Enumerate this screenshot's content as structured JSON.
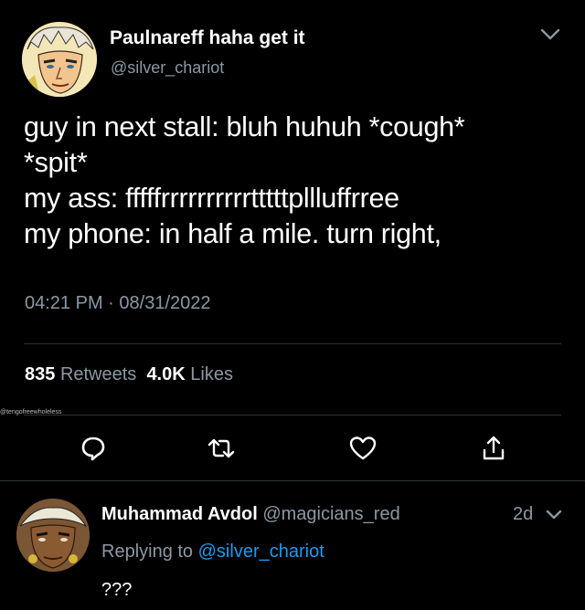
{
  "tweet": {
    "display_name": "Paulnareff haha get it",
    "handle": "@silver_chariot",
    "lines": [
      "guy in next stall: bluh huhuh *cough*",
      "*spit*",
      "my ass: fffffrrrrrrrrrrtttttpllluffrree",
      "my phone: in half a mile. turn right,"
    ],
    "time": "04:21 PM",
    "separator": "·",
    "date": "08/31/2022",
    "retweets_count": "835",
    "retweets_label": "Retweets",
    "likes_count": "4.0K",
    "likes_label": "Likes"
  },
  "watermark": "@tengofreewholeless",
  "actions": [
    "reply-icon",
    "retweet-icon",
    "like-icon",
    "share-icon"
  ],
  "reply": {
    "display_name": "Muhammad Avdol",
    "handle": "@magicians_red",
    "time": "2d",
    "replying_prefix": "Replying to",
    "replying_to": "@silver_chariot",
    "text": "???"
  },
  "colors": {
    "background": "#000000",
    "text": "#ffffff",
    "secondary": "#8b98a5",
    "link": "#1d9bf0",
    "divider": "#2f3336"
  }
}
